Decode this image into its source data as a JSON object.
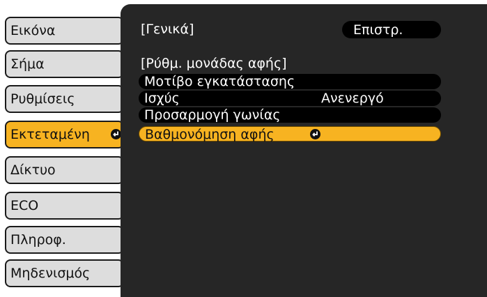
{
  "sidebar": {
    "items": [
      {
        "label": "Εικόνα"
      },
      {
        "label": "Σήμα"
      },
      {
        "label": "Ρυθμίσεις"
      },
      {
        "label": "Εκτεταμένη"
      },
      {
        "label": "Δίκτυο"
      },
      {
        "label": "ECO"
      },
      {
        "label": "Πληροφ."
      },
      {
        "label": "Μηδενισμός"
      }
    ],
    "active_index": 3
  },
  "panel": {
    "breadcrumb": "[Γενικά]",
    "back_label": "Επιστρ.",
    "section_title": "[Ρύθμ. μονάδας αφής]",
    "rows": [
      {
        "label": "Μοτίβο εγκατάστασης",
        "value": ""
      },
      {
        "label": "Ισχύς",
        "value": "Ανενεργό"
      },
      {
        "label": "Προσαρμογή γωνίας",
        "value": ""
      },
      {
        "label": "Βαθμονόμηση αφής",
        "value": ""
      }
    ],
    "selected_row": 3
  },
  "colors": {
    "accent": "#f7b321",
    "panel_bg": "#262626",
    "sidebar_bg": "#dddddd"
  },
  "icons": {
    "enter": "enter-icon"
  }
}
